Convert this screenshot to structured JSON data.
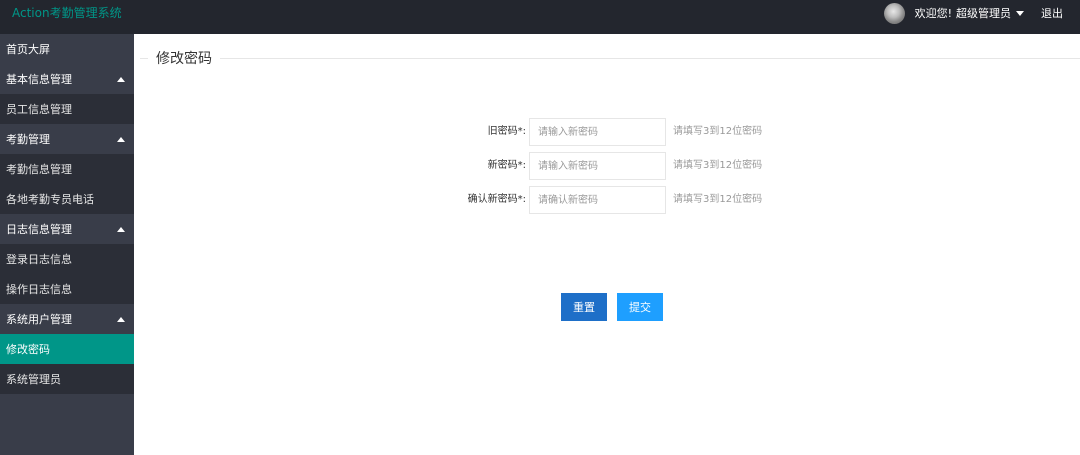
{
  "header": {
    "logo": "Action考勤管理系统",
    "welcome": "欢迎您!",
    "username": "超级管理员",
    "logout": "退出"
  },
  "sidebar": {
    "items": [
      {
        "label": "首页大屏",
        "type": "group"
      },
      {
        "label": "基本信息管理",
        "type": "group",
        "expanded": true
      },
      {
        "label": "员工信息管理",
        "type": "sub"
      },
      {
        "label": "考勤管理",
        "type": "group",
        "expanded": true
      },
      {
        "label": "考勤信息管理",
        "type": "sub"
      },
      {
        "label": "各地考勤专员电话",
        "type": "sub"
      },
      {
        "label": "日志信息管理",
        "type": "group",
        "expanded": true
      },
      {
        "label": "登录日志信息",
        "type": "sub"
      },
      {
        "label": "操作日志信息",
        "type": "sub"
      },
      {
        "label": "系统用户管理",
        "type": "group",
        "expanded": true
      },
      {
        "label": "修改密码",
        "type": "sub",
        "active": true
      },
      {
        "label": "系统管理员",
        "type": "sub"
      }
    ]
  },
  "main": {
    "title": "修改密码",
    "form": {
      "old_password": {
        "label": "旧密码*:",
        "placeholder": "请输入新密码",
        "value": "",
        "tip": "请填写3到12位密码"
      },
      "new_password": {
        "label": "新密码*:",
        "placeholder": "请输入新密码",
        "value": "",
        "tip": "请填写3到12位密码"
      },
      "confirm_password": {
        "label": "确认新密码*:",
        "placeholder": "请确认新密码",
        "value": "",
        "tip": "请填写3到12位密码"
      }
    },
    "buttons": {
      "reset": "重置",
      "submit": "提交"
    }
  },
  "colors": {
    "accent": "#009688",
    "header_bg": "#23262e",
    "sidebar_bg": "#393d49",
    "sidebar_sub_bg": "#2b2e37",
    "reset_button": "#1e6fc8",
    "submit_button": "#1e9fff"
  }
}
